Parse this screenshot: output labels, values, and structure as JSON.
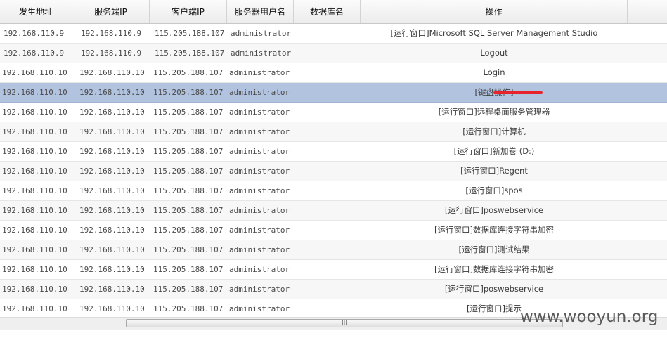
{
  "columns": [
    "发生地址",
    "服务端IP",
    "客户端IP",
    "服务器用户名",
    "数据库名",
    "操作"
  ],
  "rows": [
    {
      "src": "192.168.110.9",
      "server_ip": "192.168.110.9",
      "client_ip": "115.205.188.107",
      "user": "administrator",
      "db": "",
      "op": "[运行窗口]Microsoft SQL Server Management Studio"
    },
    {
      "src": "192.168.110.9",
      "server_ip": "192.168.110.9",
      "client_ip": "115.205.188.107",
      "user": "administrator",
      "db": "",
      "op": "Logout"
    },
    {
      "src": "192.168.110.10",
      "server_ip": "192.168.110.10",
      "client_ip": "115.205.188.107",
      "user": "administrator",
      "db": "",
      "op": "Login"
    },
    {
      "src": "192.168.110.10",
      "server_ip": "192.168.110.10",
      "client_ip": "115.205.188.107",
      "user": "administrator",
      "db": "",
      "op": "[键盘操作]"
    },
    {
      "src": "192.168.110.10",
      "server_ip": "192.168.110.10",
      "client_ip": "115.205.188.107",
      "user": "administrator",
      "db": "",
      "op": "[运行窗口]远程桌面服务管理器"
    },
    {
      "src": "192.168.110.10",
      "server_ip": "192.168.110.10",
      "client_ip": "115.205.188.107",
      "user": "administrator",
      "db": "",
      "op": "[运行窗口]计算机"
    },
    {
      "src": "192.168.110.10",
      "server_ip": "192.168.110.10",
      "client_ip": "115.205.188.107",
      "user": "administrator",
      "db": "",
      "op": "[运行窗口]新加卷 (D:)"
    },
    {
      "src": "192.168.110.10",
      "server_ip": "192.168.110.10",
      "client_ip": "115.205.188.107",
      "user": "administrator",
      "db": "",
      "op": "[运行窗口]Regent"
    },
    {
      "src": "192.168.110.10",
      "server_ip": "192.168.110.10",
      "client_ip": "115.205.188.107",
      "user": "administrator",
      "db": "",
      "op": "[运行窗口]spos"
    },
    {
      "src": "192.168.110.10",
      "server_ip": "192.168.110.10",
      "client_ip": "115.205.188.107",
      "user": "administrator",
      "db": "",
      "op": "[运行窗口]poswebservice"
    },
    {
      "src": "192.168.110.10",
      "server_ip": "192.168.110.10",
      "client_ip": "115.205.188.107",
      "user": "administrator",
      "db": "",
      "op": "[运行窗口]数据库连接字符串加密"
    },
    {
      "src": "192.168.110.10",
      "server_ip": "192.168.110.10",
      "client_ip": "115.205.188.107",
      "user": "administrator",
      "db": "",
      "op": "[运行窗口]测试结果"
    },
    {
      "src": "192.168.110.10",
      "server_ip": "192.168.110.10",
      "client_ip": "115.205.188.107",
      "user": "administrator",
      "db": "",
      "op": "[运行窗口]数据库连接字符串加密"
    },
    {
      "src": "192.168.110.10",
      "server_ip": "192.168.110.10",
      "client_ip": "115.205.188.107",
      "user": "administrator",
      "db": "",
      "op": "[运行窗口]poswebservice"
    },
    {
      "src": "192.168.110.10",
      "server_ip": "192.168.110.10",
      "client_ip": "115.205.188.107",
      "user": "administrator",
      "db": "",
      "op": "[运行窗口]提示"
    }
  ],
  "selected_row": 3,
  "scrollbar": {
    "grip": "III"
  },
  "watermark": "www.wooyun.org",
  "colors": {
    "selected_row": "#b2c3e0",
    "redaction": "#e8232c",
    "header_bg": "#efefef"
  }
}
